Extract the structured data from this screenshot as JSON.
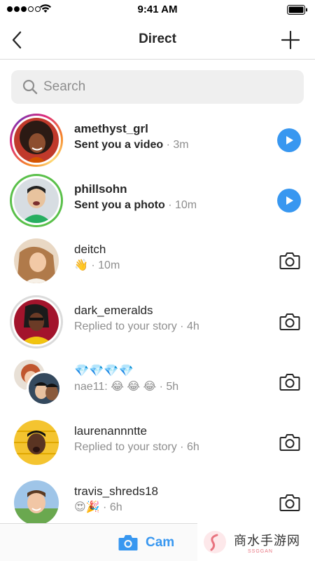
{
  "status_bar": {
    "time": "9:41 AM"
  },
  "nav": {
    "title": "Direct"
  },
  "search": {
    "placeholder": "Search"
  },
  "threads": [
    {
      "name": "amethyst_grl",
      "message": "Sent you a video",
      "time": "3m",
      "unread": true,
      "action": "play-icon",
      "ring": "story"
    },
    {
      "name": "phillsohn",
      "message": "Sent you a photo",
      "time": "10m",
      "unread": true,
      "action": "play-icon",
      "ring": "close-friends"
    },
    {
      "name": "deitch",
      "message": "👋",
      "time": "10m",
      "unread": false,
      "action": "camera-icon",
      "ring": "none"
    },
    {
      "name": "dark_emeralds",
      "message": "Replied to your story",
      "time": "4h",
      "unread": false,
      "action": "camera-icon",
      "ring": "seen"
    },
    {
      "name": "💎💎💎💎",
      "message": "nae11: 😂 😂 😂",
      "time": "5h",
      "unread": false,
      "action": "camera-icon",
      "ring": "group"
    },
    {
      "name": "laurenannntte",
      "message": "Replied to your story",
      "time": "6h",
      "unread": false,
      "action": "camera-icon",
      "ring": "none"
    },
    {
      "name": "travis_shreds18",
      "message": "😍🎉",
      "time": "6h",
      "unread": false,
      "action": "camera-icon",
      "ring": "none"
    }
  ],
  "bottom_bar": {
    "camera_label": "Cam"
  },
  "watermark": {
    "text": "商水手游网",
    "subtext": "SSGGAN"
  },
  "colors": {
    "accent": "#3897f0",
    "close_friends": "#5ac04a",
    "divider": "#dbdbdb",
    "secondary_text": "#8e8e8e"
  }
}
